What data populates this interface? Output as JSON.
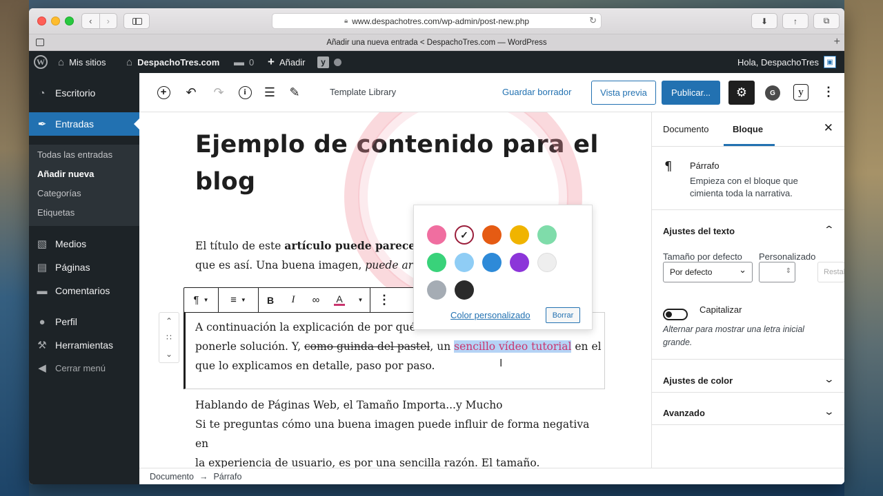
{
  "browser": {
    "url": "www.despachotres.com/wp-admin/post-new.php",
    "tab_title": "Añadir una nueva entrada < DespachoTres.com — WordPress"
  },
  "adminbar": {
    "my_sites": "Mis sitios",
    "site_name": "DespachoTres.com",
    "comments_count": "0",
    "add_new": "Añadir",
    "greeting": "Hola, DespachoTres"
  },
  "menu": {
    "dashboard": "Escritorio",
    "posts": "Entradas",
    "posts_sub": [
      "Todas las entradas",
      "Añadir nueva",
      "Categorías",
      "Etiquetas"
    ],
    "media": "Medios",
    "pages": "Páginas",
    "comments": "Comentarios",
    "profile": "Perfil",
    "tools": "Herramientas",
    "collapse": "Cerrar menú"
  },
  "toolbar": {
    "template_library": "Template Library",
    "save_draft": "Guardar borrador",
    "preview": "Vista previa",
    "publish": "Publicar..."
  },
  "post": {
    "title": "Ejemplo de contenido para el blog",
    "p1_a": "El título de este ",
    "p1_b": "artículo puede parecer c",
    "p1_c": "que es así. Una buena imagen, ",
    "p1_d": "puede arru",
    "p2_a": "A continuación la explicación de por qué ",
    "p2_b": "ponerle solución. Y, ",
    "p2_strike": "como guinda del pastel",
    "p2_c": ", un ",
    "p2_highlight": "sencillo vídeo tutorial",
    "p2_d": " en el",
    "p2_e": "que lo explicamos en detalle, paso por paso.",
    "p3_heading": "Hablando de Páginas Web, el Tamaño Importa...y Mucho",
    "p3_line1": "Si te preguntas cómo una buena imagen puede influir de forma negativa en",
    "p3_line2": "la experiencia de usuario, es por una sencilla razón. El tamaño."
  },
  "color_popover": {
    "swatches": [
      "#f06ea0",
      "#ffffff",
      "#e55b13",
      "#f0b400",
      "#7fdcaa",
      "#39d27a",
      "#8fcdf5",
      "#2e8ad8",
      "#8c35d9",
      "#eeeeee",
      "#a5acb4",
      "#2a2a2a"
    ],
    "selected_index": 1,
    "custom_color": "Color personalizado",
    "clear": "Borrar"
  },
  "breadcrumbs": {
    "document": "Documento",
    "arrow": "→",
    "block": "Párrafo"
  },
  "sidebar": {
    "tab_document": "Documento",
    "tab_block": "Bloque",
    "block_name": "Párrafo",
    "block_desc": "Empieza con el bloque que cimienta toda la narrativa.",
    "text_settings": "Ajustes del texto",
    "default_size_label": "Tamaño por defecto",
    "custom_label": "Personalizado",
    "default_size_value": "Por defecto",
    "reset": "Restablecer",
    "drop_cap": "Capitalizar",
    "drop_cap_help": "Alternar para mostrar una letra inicial grande.",
    "color_settings": "Ajustes de color",
    "advanced": "Avanzado"
  },
  "colors": {
    "wp_blue": "#2271b1",
    "admin_dark": "#1d2327",
    "highlight_text": "#c9356e",
    "selection_bg": "#b5d3f5"
  }
}
